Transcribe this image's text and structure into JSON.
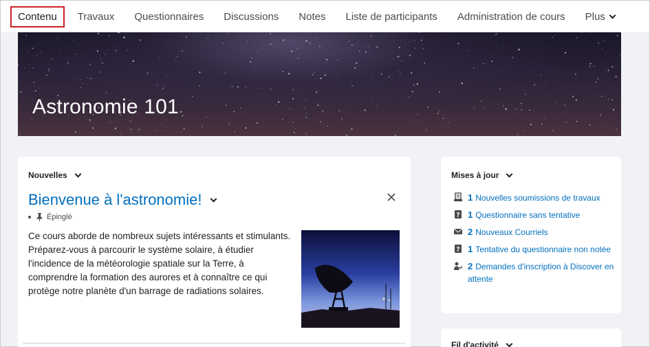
{
  "nav": {
    "items": [
      "Contenu",
      "Travaux",
      "Questionnaires",
      "Discussions",
      "Notes",
      "Liste de participants",
      "Administration de cours"
    ],
    "more_label": "Plus"
  },
  "banner": {
    "title": "Astronomie 101"
  },
  "news": {
    "header": "Nouvelles",
    "title": "Bienvenue à l'astronomie!",
    "pinned_label": "Épinglé",
    "body": "Ce cours aborde de nombreux sujets intéressants et stimulants. Préparez-vous à parcourir le système solaire, à étudier l'incidence de la météorologie spatiale sur la Terre, à comprendre la formation des aurores et à connaître ce qui protège notre planète d'un barrage de radiations solaires."
  },
  "updates": {
    "header": "Mises à jour",
    "items": [
      {
        "icon": "assignment-icon",
        "count": "1",
        "text": "Nouvelles soumissions de travaux"
      },
      {
        "icon": "quiz-icon",
        "count": "1",
        "text": "Questionnaire sans tentative"
      },
      {
        "icon": "email-icon",
        "count": "2",
        "text": "Nouveaux Courriels"
      },
      {
        "icon": "quiz-icon",
        "count": "1",
        "text": "Tentative du questionnaire non notée"
      },
      {
        "icon": "enrollment-icon",
        "count": "2",
        "text": "Demandes d'inscription à Discover en attente"
      }
    ]
  },
  "activity": {
    "header": "Fil d'activité"
  },
  "colors": {
    "accent": "#006fbf",
    "active_border": "#cd2026",
    "background": "#f1f2f5"
  }
}
